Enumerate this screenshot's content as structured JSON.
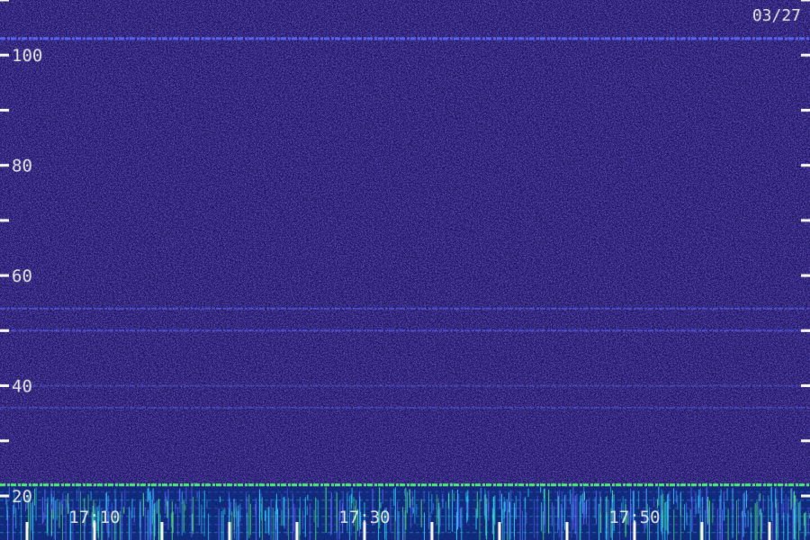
{
  "date_label": "03/27",
  "chart_data": {
    "type": "heatmap",
    "title": "",
    "xlabel": "",
    "ylabel": "",
    "ylim": [
      12,
      110
    ],
    "y_ticks": [
      20,
      30,
      40,
      50,
      60,
      70,
      80,
      90,
      100,
      110
    ],
    "y_tick_labels": [
      {
        "value": 20,
        "label": "20"
      },
      {
        "value": 40,
        "label": "40"
      },
      {
        "value": 60,
        "label": "60"
      },
      {
        "value": 80,
        "label": "80"
      },
      {
        "value": 100,
        "label": "100"
      }
    ],
    "x_ticks": [
      "17:05",
      "17:10",
      "17:15",
      "17:20",
      "17:25",
      "17:30",
      "17:35",
      "17:40",
      "17:45",
      "17:50",
      "17:55",
      "18:00"
    ],
    "x_tick_labels": [
      {
        "value": "17:10",
        "label": "17:10"
      },
      {
        "value": "17:30",
        "label": "17:30"
      },
      {
        "value": "17:50",
        "label": "17:50"
      }
    ],
    "xlim": [
      "17:03",
      "18:03"
    ],
    "horizontal_lines": [
      {
        "y": 103,
        "intensity": "strong"
      },
      {
        "y": 54,
        "intensity": "medium"
      },
      {
        "y": 50,
        "intensity": "medium"
      },
      {
        "y": 40,
        "intensity": "weak"
      },
      {
        "y": 36,
        "intensity": "weak"
      },
      {
        "y": 22,
        "intensity": "very-strong"
      }
    ],
    "grid": false,
    "colors": {
      "background": "#1a0f5c",
      "noise": "#3322aa",
      "signal_strong": "#5a6cff",
      "signal_hot": "#4ef07a",
      "signal_cyan": "#2ad0ff",
      "ticks": "#ffffff"
    }
  }
}
